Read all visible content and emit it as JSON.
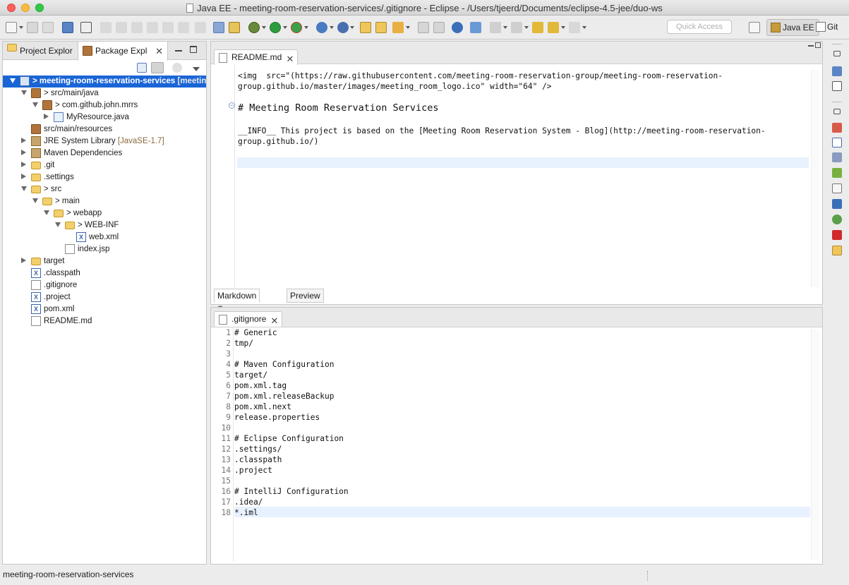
{
  "window": {
    "title": "Java EE - meeting-room-reservation-services/.gitignore - Eclipse - /Users/tjeerd/Documents/eclipse-4.5-jee/duo-ws"
  },
  "toolbar": {
    "quick_access_placeholder": "Quick Access",
    "perspectives": [
      {
        "label": "Java EE",
        "icon": "java-ee-perspective-icon",
        "active": true
      },
      {
        "label": "Git",
        "icon": "git-perspective-icon",
        "active": false
      }
    ]
  },
  "explorer": {
    "tabs": [
      {
        "label": "Project Explor",
        "icon": "project-explorer-icon",
        "active": false
      },
      {
        "label": "Package Expl",
        "icon": "package-explorer-icon",
        "active": true
      }
    ],
    "tree": [
      {
        "label": "> meeting-room-reservation-services",
        "decoration": "[meeting",
        "depth": 0,
        "twisty": "open",
        "icon": "project",
        "selected": true
      },
      {
        "label": "> src/main/java",
        "decoration": "",
        "depth": 1,
        "twisty": "open",
        "icon": "src-folder"
      },
      {
        "label": "> com.github.john.mrrs",
        "decoration": "",
        "depth": 2,
        "twisty": "open",
        "icon": "package"
      },
      {
        "label": "MyResource.java",
        "decoration": "",
        "depth": 3,
        "twisty": "closed",
        "icon": "java"
      },
      {
        "label": "src/main/resources",
        "decoration": "",
        "depth": 1,
        "twisty": "none",
        "icon": "src-folder"
      },
      {
        "label": "JRE System Library",
        "decoration": "[JavaSE-1.7]",
        "depth": 1,
        "twisty": "closed",
        "icon": "library"
      },
      {
        "label": "Maven Dependencies",
        "decoration": "",
        "depth": 1,
        "twisty": "closed",
        "icon": "library"
      },
      {
        "label": ".git",
        "decoration": "",
        "depth": 1,
        "twisty": "closed",
        "icon": "folder"
      },
      {
        "label": ".settings",
        "decoration": "",
        "depth": 1,
        "twisty": "closed",
        "icon": "folder"
      },
      {
        "label": "> src",
        "decoration": "",
        "depth": 1,
        "twisty": "open",
        "icon": "folder"
      },
      {
        "label": "> main",
        "decoration": "",
        "depth": 2,
        "twisty": "open",
        "icon": "folder"
      },
      {
        "label": "> webapp",
        "decoration": "",
        "depth": 3,
        "twisty": "open",
        "icon": "folder"
      },
      {
        "label": "> WEB-INF",
        "decoration": "",
        "depth": 4,
        "twisty": "open",
        "icon": "folder"
      },
      {
        "label": "web.xml",
        "decoration": "",
        "depth": 5,
        "twisty": "none",
        "icon": "xml"
      },
      {
        "label": "index.jsp",
        "decoration": "",
        "depth": 4,
        "twisty": "none",
        "icon": "file"
      },
      {
        "label": "target",
        "decoration": "",
        "depth": 1,
        "twisty": "closed",
        "icon": "folder"
      },
      {
        "label": ".classpath",
        "decoration": "",
        "depth": 1,
        "twisty": "none",
        "icon": "xml"
      },
      {
        "label": ".gitignore",
        "decoration": "",
        "depth": 1,
        "twisty": "none",
        "icon": "file"
      },
      {
        "label": ".project",
        "decoration": "",
        "depth": 1,
        "twisty": "none",
        "icon": "xml"
      },
      {
        "label": "pom.xml",
        "decoration": "",
        "depth": 1,
        "twisty": "none",
        "icon": "xml"
      },
      {
        "label": "README.md",
        "decoration": "",
        "depth": 1,
        "twisty": "none",
        "icon": "file"
      }
    ]
  },
  "readme_editor": {
    "tab_label": "README.md",
    "lines": [
      "<img  src=\"(https://raw.githubusercontent.com/meeting-room-reservation-group/meeting-room-reservation-",
      "group.github.io/master/images/meeting_room_logo.ico\" width=\"64\" />",
      "",
      "# Meeting Room Reservation Services",
      "",
      "__INFO__ This project is based on the [Meeting Room Reservation System - Blog](http://meeting-room-reservation-",
      "group.github.io/)"
    ],
    "bottom_tabs": [
      {
        "label": "Markdown Source",
        "active": true
      },
      {
        "label": "Preview",
        "active": false
      }
    ]
  },
  "gitignore_editor": {
    "tab_label": ".gitignore",
    "lines": [
      "# Generic",
      "tmp/",
      "",
      "# Maven Configuration",
      "target/",
      "pom.xml.tag",
      "pom.xml.releaseBackup",
      "pom.xml.next",
      "release.properties",
      "",
      "# Eclipse Configuration",
      ".settings/",
      ".classpath",
      ".project",
      "",
      "# IntelliJ Configuration",
      ".idea/",
      "*.iml"
    ],
    "line_numbers": [
      "1",
      "2",
      "3",
      "4",
      "5",
      "6",
      "7",
      "8",
      "9",
      "10",
      "11",
      "12",
      "13",
      "14",
      "15",
      "16",
      "17",
      "18"
    ]
  },
  "status": {
    "selection": "meeting-room-reservation-services"
  },
  "colors": {
    "selection": "#1a65d6",
    "current_line": "#e8f2fe"
  }
}
